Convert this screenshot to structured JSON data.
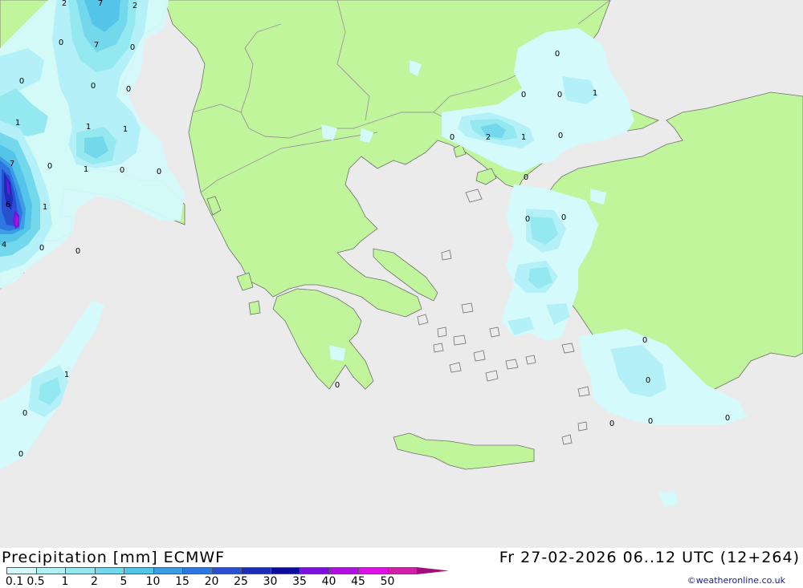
{
  "header": {
    "title": "Precipitation [mm] ECMWF",
    "datetime": "Fr 27-02-2026 06..12 UTC (12+264)",
    "credit": "©weatheronline.co.uk"
  },
  "legend": {
    "labels": [
      "0.1",
      "0.5",
      "1",
      "2",
      "5",
      "10",
      "15",
      "20",
      "25",
      "30",
      "35",
      "40",
      "45",
      "50"
    ],
    "colors": [
      "#d4fafc",
      "#b4f0f8",
      "#94e8f0",
      "#74d8ec",
      "#54c4e8",
      "#3c9ce4",
      "#2c78e0",
      "#2850d0",
      "#1c2cb8",
      "#0c0c9c",
      "#7c10dc",
      "#b010e0",
      "#e010e8",
      "#d020a8",
      "#a01078"
    ]
  },
  "map": {
    "colors": {
      "sea": "#ebebeb",
      "land": "#c0f59c",
      "border": "#9a9a9a",
      "coast": "#707070"
    },
    "value_labels": [
      "2",
      "7",
      "2",
      "0",
      "7",
      "0",
      "0",
      "0",
      "0",
      "1",
      "1",
      "1",
      "1",
      "0",
      "0",
      "0",
      "7",
      "6",
      "1",
      "4",
      "0",
      "0",
      "0",
      "0",
      "0",
      "1",
      "0",
      "2",
      "1",
      "0",
      "0",
      "0",
      "0",
      "0",
      "0",
      "0",
      "0",
      "0",
      "0",
      "1",
      "0",
      "0"
    ]
  }
}
